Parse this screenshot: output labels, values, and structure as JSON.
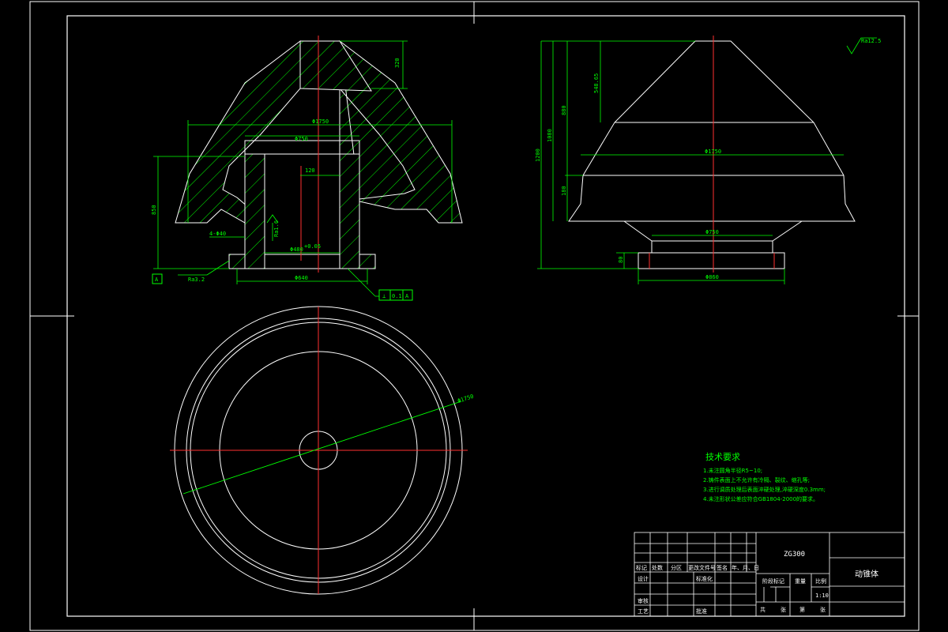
{
  "dimensions": {
    "front_top_height": "320",
    "front_outer_dia": "Φ1750",
    "front_inner_top": "Φ750",
    "front_gap": "120",
    "front_height": "850",
    "front_chamfer": "4-Φ40",
    "front_roughness": "Ra3.2",
    "front_inner_roughness": "Ra1.6",
    "front_bore": "Φ480",
    "front_bore_tol": "+0.05",
    "front_base_dia": "Φ640",
    "datum": "A",
    "tolerance_frame": [
      "⊥",
      "0.1",
      "A"
    ],
    "side_roughness_top": "Ra12.5",
    "side_top_height": "548.65",
    "side_mid_height": "880",
    "side_total_1": "1080",
    "side_total_2": "1200",
    "side_low_height": "180",
    "side_outer_dia": "Φ1750",
    "side_base_dim": "Φ750",
    "side_base_height": "80",
    "side_foot_dia": "Φ860",
    "plan_dia": "Φ1750"
  },
  "notes": {
    "title": "技术要求",
    "items": [
      "1.未注圆角半径R5~10;",
      "2.铸件表面上不允许有冷隔、裂纹、缩孔等;",
      "3.进行调质处理后表面淬硬处理,淬硬深度0.3mm;",
      "4.未注形状公差应符合GB1804-2000的要求。"
    ]
  },
  "title_block": {
    "material": "ZG300",
    "part_name": "动锥体",
    "scale_label": "比例",
    "scale": "1:10",
    "weight_label": "重量",
    "stage_label": "阶段标记",
    "row_labels": [
      "标记",
      "处数",
      "分区",
      "更改文件号",
      "签名",
      "年、月、日"
    ],
    "design": "设计",
    "standard": "标准化",
    "review": "审核",
    "process": "工艺",
    "approve": "批准",
    "sheets": [
      "共",
      "张",
      "第",
      "张"
    ]
  }
}
